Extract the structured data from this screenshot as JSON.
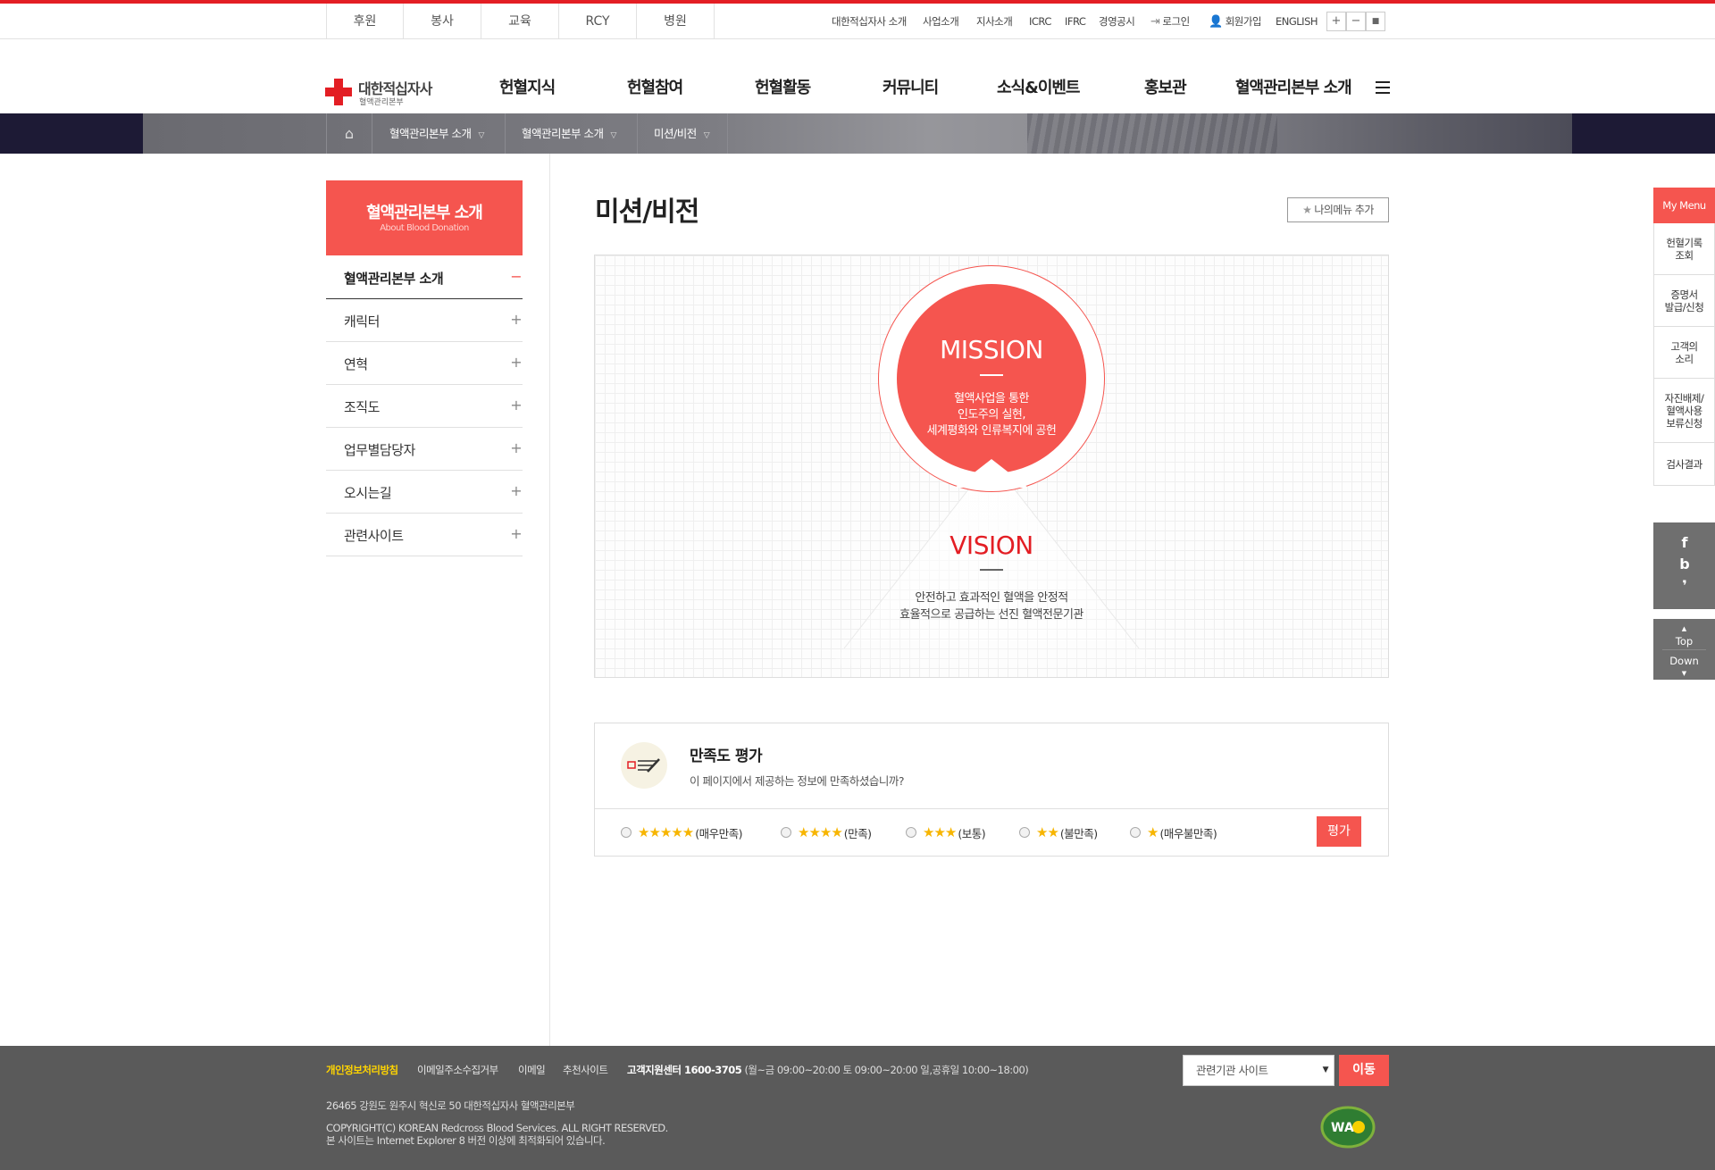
{
  "utility": {
    "tabs": [
      "후원",
      "봉사",
      "교육",
      "RCY",
      "병원"
    ],
    "links": [
      "대한적십자사 소개",
      "사업소개",
      "지사소개",
      "ICRC",
      "IFRC",
      "경영공시"
    ],
    "login": "로그인",
    "signup": "회원가입",
    "english": "ENGLISH",
    "zoom": [
      "+",
      "−",
      "■"
    ]
  },
  "header": {
    "logo_title": "대한적십자사",
    "logo_sub": "혈액관리본부",
    "gnb": [
      "헌혈지식",
      "헌혈참여",
      "헌혈활동",
      "커뮤니티",
      "소식&이벤트",
      "홍보관",
      "혈액관리본부 소개"
    ]
  },
  "breadcrumb": [
    "혈액관리본부 소개",
    "혈액관리본부 소개",
    "미션/비전"
  ],
  "lnb": {
    "title": "혈액관리본부 소개",
    "subtitle": "About Blood Donation",
    "items": [
      {
        "label": "혈액관리본부 소개",
        "sign": "−"
      },
      {
        "label": "캐릭터",
        "sign": "+"
      },
      {
        "label": "연혁",
        "sign": "+"
      },
      {
        "label": "조직도",
        "sign": "+"
      },
      {
        "label": "업무별담당자",
        "sign": "+"
      },
      {
        "label": "오시는길",
        "sign": "+"
      },
      {
        "label": "관련사이트",
        "sign": "+"
      }
    ]
  },
  "main": {
    "title": "미션/비전",
    "mymenu_add": "나의메뉴 추가",
    "mission_title": "MISSION",
    "mission_lines": [
      "혈액사업을 통한",
      "인도주의 실현,",
      "세계평화와 인류복지에 공헌"
    ],
    "vision_title": "VISION",
    "vision_lines": [
      "안전하고 효과적인 혈액을 안정적",
      "효율적으로 공급하는 선진 혈액전문기관"
    ]
  },
  "survey": {
    "title": "만족도 평가",
    "question": "이 페이지에서 제공하는 정보에 만족하셨습니까?",
    "options": [
      {
        "stars": "★★★★★",
        "label": "(매우만족)",
        "rating": 5
      },
      {
        "stars": "★★★★",
        "label": "(만족)",
        "rating": 4
      },
      {
        "stars": "★★★",
        "label": "(보통)",
        "rating": 3
      },
      {
        "stars": "★★",
        "label": "(불만족)",
        "rating": 2
      },
      {
        "stars": "★",
        "label": "(매우불만족)",
        "rating": 1
      }
    ],
    "submit": "평가"
  },
  "quickmenu": {
    "title": "My Menu",
    "items": [
      "헌혈기록\n조회",
      "증명서\n발급/신청",
      "고객의\n소리",
      "자진배제/\n혈액사용\n보류신청",
      "검사결과"
    ],
    "sns": [
      "f",
      "b",
      "❜"
    ],
    "top": "Top",
    "down": "Down"
  },
  "footer": {
    "privacy": "개인정보처리방침",
    "links": [
      "이메일주소수집거부",
      "이메일",
      "추천사이트"
    ],
    "center": "고객지원센터 1600-3705",
    "hours": "(월~금 09:00~20:00 토 09:00~20:00 일,공휴일 10:00~18:00)",
    "address": "26465 강원도 원주시 혁신로 50 대한적십자사 혈액관리본부",
    "copyright": "COPYRIGHT(C) KOREAN Redcross Blood Services. ALL RIGHT RESERVED.",
    "browser_note": "본 사이트는 Internet Explorer 8 버전 이상에 최적화되어 있습니다.",
    "select_placeholder": "관련기관 사이트",
    "go": "이동",
    "wa_mark": "WA"
  },
  "colors": {
    "accent": "#f5554f",
    "brand_red": "#e31e24",
    "band": "#1d1a35",
    "footer": "#5a5a5a",
    "star": "#f7b500"
  }
}
